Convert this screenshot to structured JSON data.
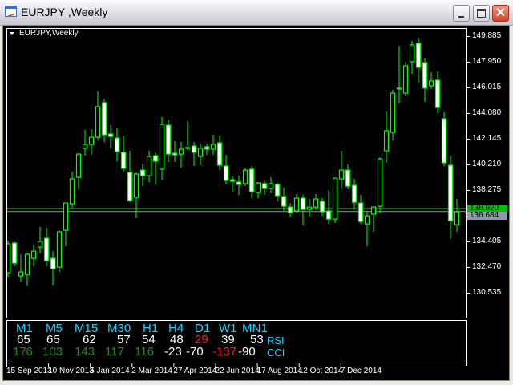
{
  "window": {
    "title": "EURJPY ,Weekly",
    "close_glyph": "✕"
  },
  "chart": {
    "title": "EURJPY,Weekly",
    "bull_color": "#00ff00",
    "bear_body": "#ffffff",
    "bid_price": "136.920",
    "last_price": "136.684",
    "bid_line_color": "#00c000",
    "last_line_color": "#8c99a6",
    "y_range": [
      129.97,
      150.5
    ],
    "y_ticks": [
      "149.885",
      "147.950",
      "146.015",
      "144.080",
      "142.145",
      "140.210",
      "138.275",
      "136.340",
      "134.405",
      "132.470",
      "130.535"
    ],
    "x_labels": [
      "15 Sep 2013",
      "10 Nov 2013",
      "5 Jan 2014",
      "2 Mar 2014",
      "27 Apr 2014",
      "22 Jun 2014",
      "17 Aug 2014",
      "12 Oct 2014",
      "7 Dec 2014"
    ],
    "candles_ohlc": [
      [
        132.04,
        134.46,
        131.74,
        134.22
      ],
      [
        134.28,
        134.4,
        132.52,
        132.77
      ],
      [
        131.8,
        133.43,
        131.31,
        132.1
      ],
      [
        131.92,
        133.55,
        131.07,
        133.43
      ],
      [
        133.13,
        134.16,
        132.52,
        133.67
      ],
      [
        133.98,
        135.49,
        133.49,
        134.4
      ],
      [
        134.64,
        135.43,
        132.52,
        132.95
      ],
      [
        133.13,
        133.67,
        131.13,
        132.34
      ],
      [
        132.46,
        135.25,
        132.1,
        135.13
      ],
      [
        135.25,
        137.3,
        134.04,
        137.3
      ],
      [
        137.24,
        139.66,
        136.94,
        139.12
      ],
      [
        139.24,
        141.05,
        138.33,
        140.99
      ],
      [
        141.42,
        142.81,
        140.87,
        141.72
      ],
      [
        141.72,
        142.87,
        140.93,
        142.26
      ],
      [
        142.26,
        145.71,
        142.02,
        144.56
      ],
      [
        144.87,
        145.17,
        141.9,
        142.45
      ],
      [
        142.51,
        143.17,
        141.42,
        142.32
      ],
      [
        142.2,
        142.93,
        140.45,
        141.18
      ],
      [
        141.12,
        142.39,
        139.66,
        139.91
      ],
      [
        139.6,
        141.24,
        137.36,
        137.49
      ],
      [
        137.73,
        139.6,
        136.15,
        139.48
      ],
      [
        139.78,
        140.27,
        138.57,
        139.36
      ],
      [
        139.36,
        141.24,
        138.88,
        140.81
      ],
      [
        140.87,
        141.12,
        138.7,
        140.45
      ],
      [
        139.85,
        143.78,
        139.06,
        143.23
      ],
      [
        143.17,
        143.6,
        140.39,
        140.99
      ],
      [
        141.05,
        141.96,
        140.39,
        140.93
      ],
      [
        140.99,
        141.9,
        139.97,
        141.36
      ],
      [
        141.48,
        143.47,
        141.3,
        141.48
      ],
      [
        141.6,
        141.9,
        140.09,
        141.12
      ],
      [
        140.81,
        141.78,
        140.15,
        141.42
      ],
      [
        141.54,
        141.78,
        140.93,
        141.36
      ],
      [
        141.36,
        142.45,
        140.93,
        141.72
      ],
      [
        141.84,
        142.39,
        139.78,
        140.15
      ],
      [
        140.09,
        140.93,
        138.7,
        139.0
      ],
      [
        139.06,
        139.3,
        138.09,
        138.94
      ],
      [
        138.88,
        139.36,
        137.91,
        138.7
      ],
      [
        138.76,
        139.97,
        138.57,
        139.78
      ],
      [
        139.85,
        140.09,
        137.67,
        138.15
      ],
      [
        138.09,
        138.88,
        137.67,
        138.82
      ],
      [
        138.76,
        138.94,
        137.91,
        138.39
      ],
      [
        138.39,
        139.24,
        138.03,
        138.76
      ],
      [
        138.7,
        138.82,
        137.42,
        137.85
      ],
      [
        137.79,
        138.45,
        136.7,
        137.06
      ],
      [
        137.0,
        137.3,
        136.27,
        136.58
      ],
      [
        136.7,
        137.97,
        136.58,
        137.67
      ],
      [
        137.67,
        137.91,
        135.61,
        136.82
      ],
      [
        136.82,
        137.61,
        136.27,
        137.0
      ],
      [
        137.0,
        137.97,
        136.76,
        137.61
      ],
      [
        137.42,
        137.67,
        136.33,
        136.64
      ],
      [
        136.7,
        138.27,
        135.73,
        136.09
      ],
      [
        136.09,
        139.18,
        135.79,
        139.18
      ],
      [
        139.12,
        141.24,
        138.39,
        139.78
      ],
      [
        139.78,
        140.21,
        138.33,
        138.57
      ],
      [
        138.63,
        139.12,
        136.82,
        137.36
      ],
      [
        137.3,
        137.91,
        135.73,
        135.91
      ],
      [
        135.73,
        136.7,
        134.04,
        136.33
      ],
      [
        136.46,
        137.06,
        135.13,
        137.0
      ],
      [
        137.06,
        140.75,
        136.52,
        140.63
      ],
      [
        141.24,
        144.2,
        140.33,
        142.75
      ],
      [
        142.63,
        145.83,
        142.02,
        145.59
      ],
      [
        145.96,
        149.16,
        144.81,
        145.96
      ],
      [
        145.59,
        147.95,
        145.35,
        147.65
      ],
      [
        147.95,
        149.52,
        147.04,
        149.22
      ],
      [
        149.34,
        149.77,
        146.38,
        147.53
      ],
      [
        147.89,
        148.25,
        144.93,
        145.96
      ],
      [
        146.14,
        147.16,
        145.9,
        146.5
      ],
      [
        146.56,
        147.22,
        144.08,
        144.5
      ],
      [
        143.66,
        144.14,
        140.09,
        140.33
      ],
      [
        140.15,
        140.87,
        134.64,
        135.97
      ],
      [
        135.67,
        137.61,
        135.13,
        136.64
      ]
    ]
  },
  "indicator": {
    "timeframes": [
      "M1",
      "M5",
      "M15",
      "M30",
      "H1",
      "H4",
      "D1",
      "W1",
      "MN1"
    ],
    "rsi_label": "RSI",
    "cci_label": "CCI",
    "rsi": [
      {
        "v": "65",
        "c": "white"
      },
      {
        "v": "65",
        "c": "white"
      },
      {
        "v": "62",
        "c": "white"
      },
      {
        "v": "57",
        "c": "white"
      },
      {
        "v": "54",
        "c": "white"
      },
      {
        "v": "48",
        "c": "white"
      },
      {
        "v": "29",
        "c": "red"
      },
      {
        "v": "39",
        "c": "white"
      },
      {
        "v": "53",
        "c": "white"
      }
    ],
    "cci": [
      {
        "v": "176",
        "c": "green"
      },
      {
        "v": "103",
        "c": "green"
      },
      {
        "v": "143",
        "c": "green"
      },
      {
        "v": "117",
        "c": "green"
      },
      {
        "v": "116",
        "c": "green"
      },
      {
        "v": "-23",
        "c": "white"
      },
      {
        "v": "-70",
        "c": "white"
      },
      {
        "v": "-137",
        "c": "red"
      },
      {
        "v": "-90",
        "c": "white"
      }
    ]
  }
}
